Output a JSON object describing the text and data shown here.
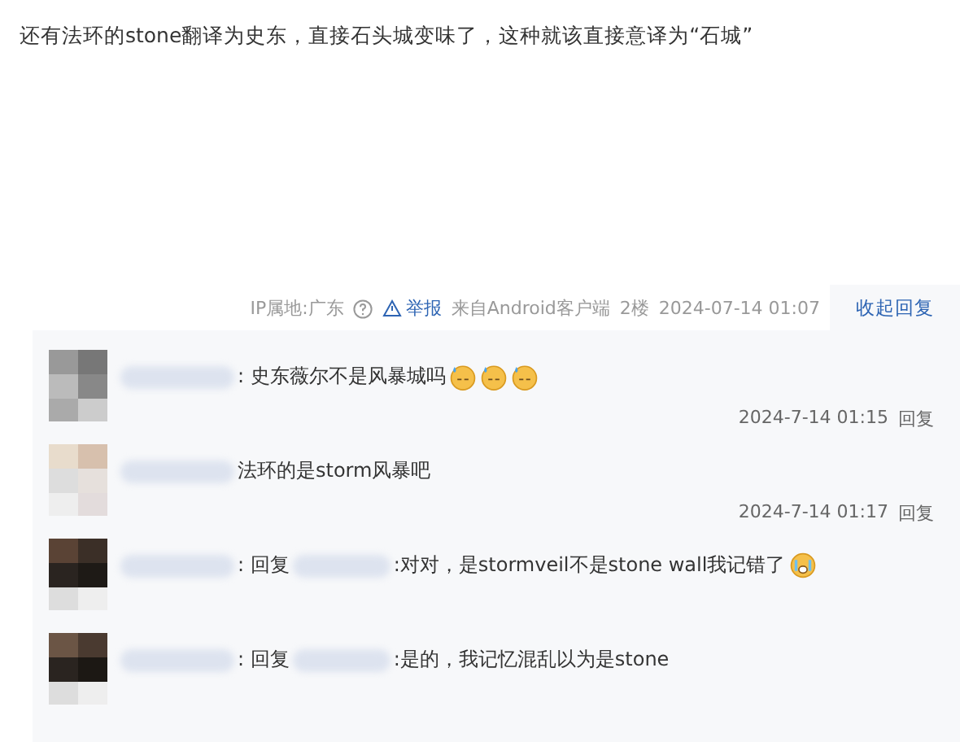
{
  "post": {
    "text": "还有法环的stone翻译为史东，直接石头城变味了，这种就该直接意译为“石城”"
  },
  "meta": {
    "ip": "IP属地:广东",
    "report": "举报",
    "source": "来自Android客户端",
    "floor": "2楼",
    "time": "2024-07-14 01:07",
    "toggle": "收起回复"
  },
  "comments": [
    {
      "text": ": 史东薇尔不是风暴城吗",
      "emoji": [
        {
          "kind": "sweat"
        },
        {
          "kind": "sweat"
        },
        {
          "kind": "sweat"
        }
      ],
      "time": "2024-7-14 01:15",
      "reply": "回复"
    },
    {
      "text": "法环的是storm风暴吧",
      "time": "2024-7-14 01:17",
      "reply": "回复"
    },
    {
      "reply_prefix": ": 回复",
      "text": ":对对，是stormveil不是stone wall我记错了",
      "emoji": [
        {
          "kind": "cry"
        }
      ]
    },
    {
      "reply_prefix": ": 回复",
      "text": ":是的，我记忆混乱以为是stone"
    }
  ]
}
